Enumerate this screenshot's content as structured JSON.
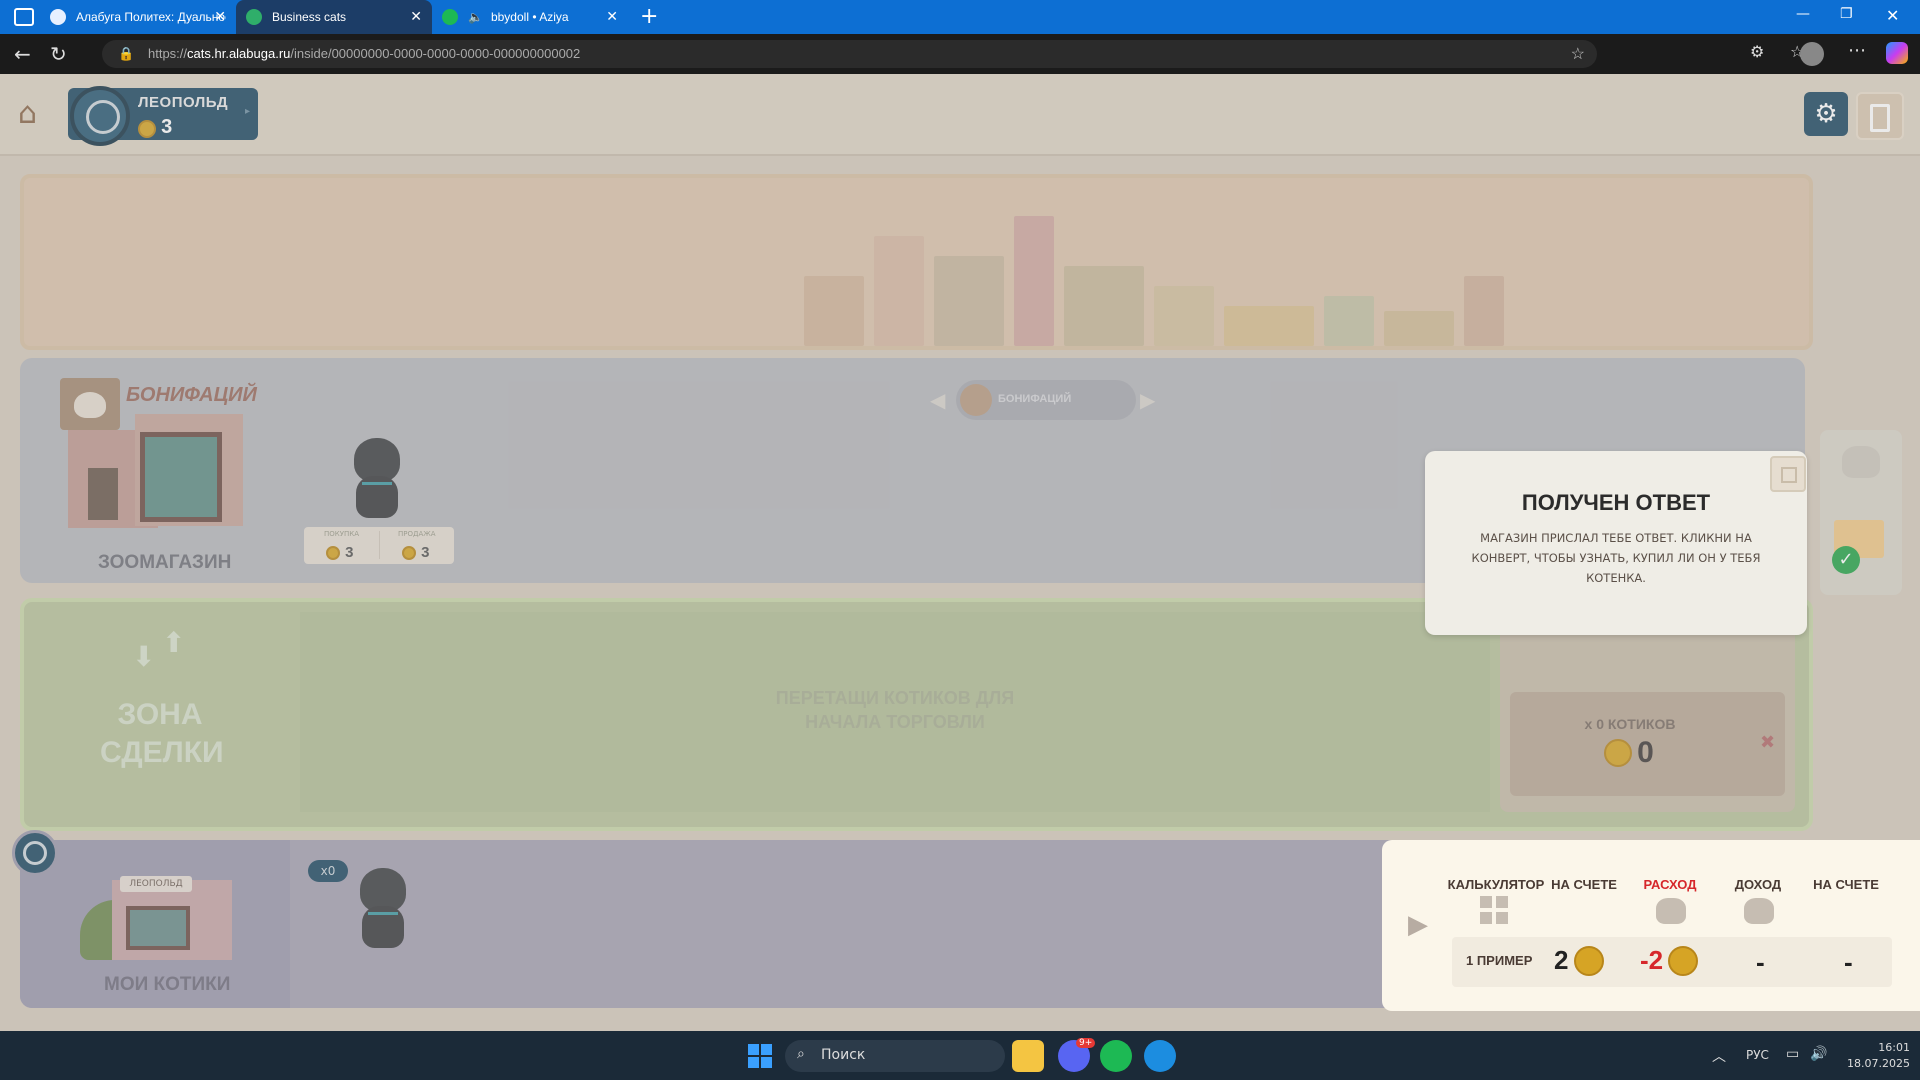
{
  "browser": {
    "tabs": [
      {
        "label": "Алабуга Политех: Дуальное обр",
        "active": false
      },
      {
        "label": "Business cats",
        "active": true
      },
      {
        "label": "bbydoll • Aziya",
        "active": false
      }
    ],
    "url_prefix": "https://",
    "url_host": "cats.hr.alabuga.ru",
    "url_path": "/inside/00000000-0000-0000-0000-000000000002",
    "new_tab": "+"
  },
  "header": {
    "player_name": "ЛЕОПОЛЬД",
    "player_coins": "3"
  },
  "shop": {
    "owner_name": "БОНИФАЦИЙ",
    "type_label": "ЗООМАГАЗИН",
    "buy_label": "ПОКУПКА",
    "sell_label": "ПРОДАЖА",
    "buy_price": "3",
    "sell_price": "3",
    "carousel_name": "БОНИФАЦИЙ"
  },
  "deal": {
    "zone_line1": "ЗОНА",
    "zone_line2": "СДЕЛКИ",
    "hint_line1": "ПЕРЕТАЩИ КОТИКОВ ДЛЯ",
    "hint_line2": "НАЧАЛА ТОРГОВЛИ",
    "summary_count": "x 0 КОТИКОВ",
    "summary_total": "0"
  },
  "mine": {
    "house_label": "ЛЕОПОЛЬД",
    "section_label": "МОИ КОТИКИ",
    "cat_count": "x0"
  },
  "popup": {
    "title": "ПОЛУЧЕН ОТВЕТ",
    "text": "МАГАЗИН ПРИСЛАЛ ТЕБЕ ОТВЕТ. КЛИКНИ НА КОНВЕРТ, ЧТОБЫ УЗНАТЬ, КУПИЛ ЛИ ОН У ТЕБЯ КОТЕНКА."
  },
  "calculator": {
    "headers": [
      "КАЛЬКУЛЯТОР",
      "НА СЧЕТЕ",
      "РАСХОД",
      "ДОХОД",
      "НА СЧЕТЕ"
    ],
    "row_label": "1 ПРИМЕР",
    "balance": "2",
    "expense": "-2",
    "income": "-",
    "balance_after": "-"
  },
  "taskbar": {
    "search_placeholder": "Поиск",
    "discord_badge": "9+",
    "lang": "РУС",
    "time": "16:01",
    "date": "18.07.2025"
  },
  "colors": {
    "tabbar": "#0d6fd3",
    "accent_dark": "#1f4a63",
    "expense_red": "#d6272b",
    "coin": "#d6a425",
    "check_green": "#27a54a"
  }
}
